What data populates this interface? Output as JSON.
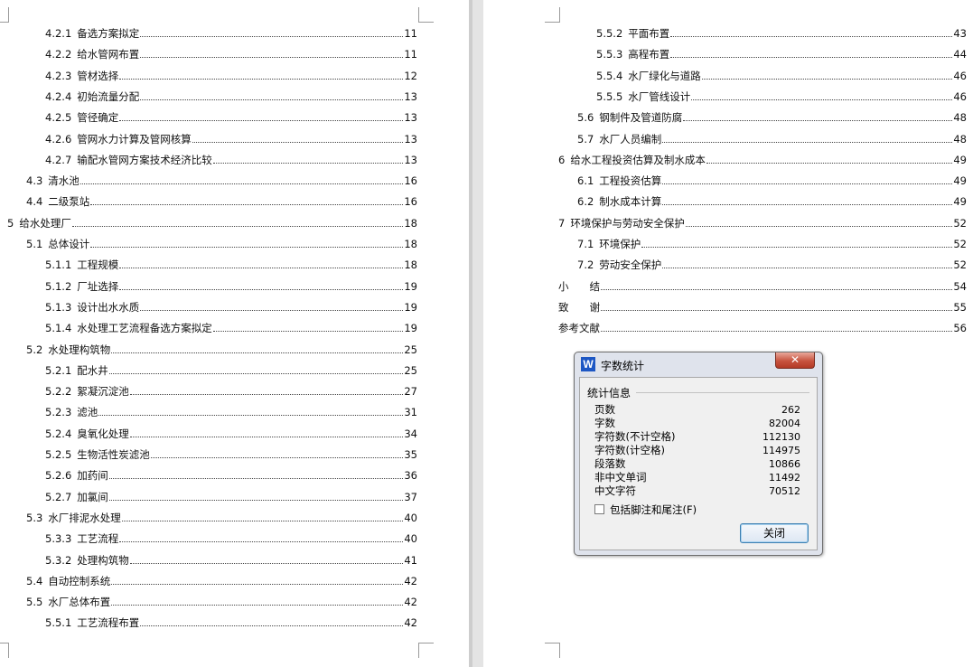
{
  "left_page": {
    "toc": [
      {
        "num": "4.2.1",
        "title": "备选方案拟定",
        "page": "11"
      },
      {
        "num": "4.2.2",
        "title": "给水管网布置",
        "page": "11"
      },
      {
        "num": "4.2.3",
        "title": "管材选择",
        "page": "12"
      },
      {
        "num": "4.2.4",
        "title": "初始流量分配",
        "page": "13"
      },
      {
        "num": "4.2.5",
        "title": "管径确定",
        "page": "13"
      },
      {
        "num": "4.2.6",
        "title": "管网水力计算及管网核算",
        "page": "13"
      },
      {
        "num": "4.2.7",
        "title": "输配水管网方案技术经济比较",
        "page": "13"
      },
      {
        "num": "4.3",
        "title": "清水池",
        "page": "16"
      },
      {
        "num": "4.4",
        "title": "二级泵站",
        "page": "16"
      },
      {
        "num": "5",
        "title": "给水处理厂",
        "page": "18"
      },
      {
        "num": "5.1",
        "title": "总体设计",
        "page": "18"
      },
      {
        "num": "5.1.1",
        "title": "工程规模",
        "page": "18"
      },
      {
        "num": "5.1.2",
        "title": "厂址选择",
        "page": "19"
      },
      {
        "num": "5.1.3",
        "title": "设计出水水质",
        "page": "19"
      },
      {
        "num": "5.1.4",
        "title": "水处理工艺流程备选方案拟定",
        "page": "19"
      },
      {
        "num": "5.2",
        "title": "水处理构筑物",
        "page": "25"
      },
      {
        "num": "5.2.1",
        "title": "配水井",
        "page": "25"
      },
      {
        "num": "5.2.2",
        "title": "絮凝沉淀池",
        "page": "27"
      },
      {
        "num": "5.2.3",
        "title": "滤池",
        "page": "31"
      },
      {
        "num": "5.2.4",
        "title": "臭氧化处理",
        "page": "34"
      },
      {
        "num": "5.2.5",
        "title": "生物活性炭滤池",
        "page": "35"
      },
      {
        "num": "5.2.6",
        "title": "加药间",
        "page": "36"
      },
      {
        "num": "5.2.7",
        "title": "加氯间",
        "page": "37"
      },
      {
        "num": "5.3",
        "title": "水厂排泥水处理",
        "page": "40"
      },
      {
        "num": "5.3.3",
        "title": "工艺流程",
        "page": "40"
      },
      {
        "num": "5.3.2",
        "title": "处理构筑物",
        "page": "41"
      },
      {
        "num": "5.4",
        "title": "自动控制系统",
        "page": "42"
      },
      {
        "num": "5.5",
        "title": "水厂总体布置",
        "page": "42"
      },
      {
        "num": "5.5.1",
        "title": "工艺流程布置",
        "page": "42"
      }
    ]
  },
  "right_page": {
    "toc": [
      {
        "num": "5.5.2",
        "title": "平面布置",
        "page": "43"
      },
      {
        "num": "5.5.3",
        "title": "高程布置",
        "page": "44"
      },
      {
        "num": "5.5.4",
        "title": "水厂绿化与道路",
        "page": "46"
      },
      {
        "num": "5.5.5",
        "title": "水厂管线设计",
        "page": "46"
      },
      {
        "num": "5.6",
        "title": "钢制件及管道防腐",
        "page": "48"
      },
      {
        "num": "5.7",
        "title": "水厂人员编制",
        "page": "48"
      },
      {
        "num": "6",
        "title": "给水工程投资估算及制水成本",
        "page": "49"
      },
      {
        "num": "6.1",
        "title": "工程投资估算",
        "page": "49"
      },
      {
        "num": "6.2",
        "title": "制水成本计算",
        "page": "49"
      },
      {
        "num": "7",
        "title": "环境保护与劳动安全保护",
        "page": "52"
      },
      {
        "num": "7.1",
        "title": "环境保护",
        "page": "52"
      },
      {
        "num": "7.2",
        "title": "劳动安全保护",
        "page": "52"
      },
      {
        "num": "",
        "title": "小　　结",
        "page": "54"
      },
      {
        "num": "",
        "title": "致　　谢",
        "page": "55"
      },
      {
        "num": "",
        "title": "参考文献",
        "page": "56"
      }
    ]
  },
  "dialog": {
    "title": "字数统计",
    "app_icon": "W",
    "close_glyph": "✕",
    "group_label": "统计信息",
    "stats": [
      {
        "label": "页数",
        "value": "262"
      },
      {
        "label": "字数",
        "value": "82004"
      },
      {
        "label": "字符数(不计空格)",
        "value": "112130"
      },
      {
        "label": "字符数(计空格)",
        "value": "114975"
      },
      {
        "label": "段落数",
        "value": "10866"
      },
      {
        "label": "非中文单词",
        "value": "11492"
      },
      {
        "label": "中文字符",
        "value": "70512"
      }
    ],
    "checkbox_label": "包括脚注和尾注(F)",
    "checkbox_checked": false,
    "close_button_label": "关闭"
  }
}
